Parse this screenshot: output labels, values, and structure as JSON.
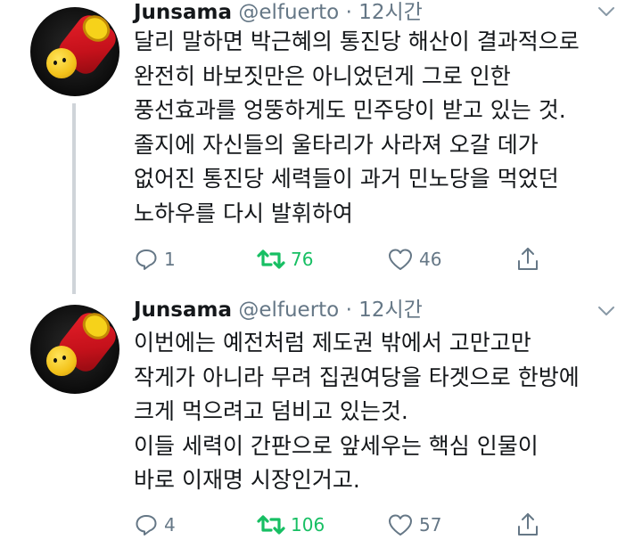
{
  "colors": {
    "text": "#14171a",
    "secondary": "#657786",
    "retweet_active": "#17bf63",
    "thread_line": "#cfd4d9"
  },
  "icons": {
    "reply": "reply-icon",
    "retweet": "retweet-icon",
    "like": "heart-icon",
    "share": "share-icon",
    "menu": "chevron-down-icon"
  },
  "tweets": [
    {
      "display_name": "Junsama",
      "handle": "@elfuerto",
      "separator": "·",
      "time": "12시간",
      "lines": [
        "달리 말하면 박근혜의 통진당 해산이 결과적으로",
        "완전히 바보짓만은 아니었던게 그로 인한",
        "풍선효과를 엉뚱하게도 민주당이 받고 있는 것.",
        "졸지에 자신들의 울타리가 사라져 오갈 데가",
        "없어진 통진당 세력들이 과거 민노당을 먹었던",
        "노하우를 다시 발휘하여"
      ],
      "replies": "1",
      "retweets": "76",
      "likes": "46"
    },
    {
      "display_name": "Junsama",
      "handle": "@elfuerto",
      "separator": "·",
      "time": "12시간",
      "lines": [
        "이번에는 예전처럼 제도권 밖에서 고만고만",
        "작게가 아니라 무려 집권여당을 타겟으로 한방에",
        "크게 먹으려고 덤비고 있는것.",
        "이들 세력이 간판으로 앞세우는 핵심 인물이",
        "바로 이재명 시장인거고."
      ],
      "replies": "4",
      "retweets": "106",
      "likes": "57"
    }
  ]
}
